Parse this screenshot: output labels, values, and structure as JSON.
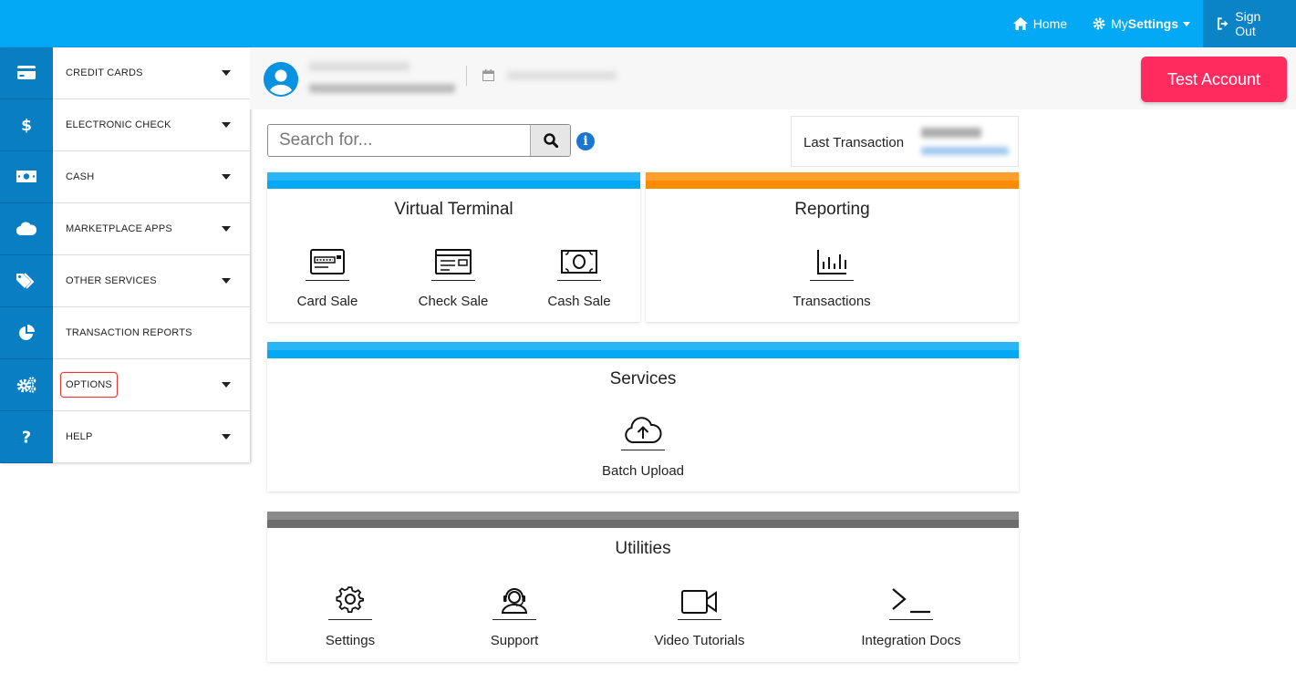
{
  "topnav": {
    "home": "Home",
    "my": "My ",
    "settings": "Settings",
    "signout": "Sign Out"
  },
  "sidebar": {
    "items": [
      {
        "label": "CREDIT CARDS",
        "icon": "credit-card-icon"
      },
      {
        "label": "ELECTRONIC CHECK",
        "icon": "dollar-icon"
      },
      {
        "label": "CASH",
        "icon": "cash-icon"
      },
      {
        "label": "MARKETPLACE APPS",
        "icon": "cloud-icon"
      },
      {
        "label": "OTHER SERVICES",
        "icon": "tags-icon"
      },
      {
        "label": "TRANSACTION REPORTS",
        "icon": "pie-chart-icon"
      },
      {
        "label": "OPTIONS",
        "icon": "cogs-icon"
      },
      {
        "label": "HELP",
        "icon": "question-icon"
      }
    ]
  },
  "header": {
    "test_account": "Test Account"
  },
  "search": {
    "placeholder": "Search for..."
  },
  "last_transaction": {
    "label": "Last Transaction"
  },
  "virtual_terminal": {
    "title": "Virtual Terminal",
    "tiles": [
      "Card Sale",
      "Check Sale",
      "Cash Sale"
    ]
  },
  "reporting": {
    "title": "Reporting",
    "tiles": [
      "Transactions"
    ]
  },
  "services": {
    "title": "Services",
    "tiles": [
      "Batch Upload"
    ]
  },
  "utilities": {
    "title": "Utilities",
    "tiles": [
      "Settings",
      "Support",
      "Video Tutorials",
      "Integration Docs"
    ]
  },
  "colors": {
    "topbar": "#03a9f4",
    "sidebar_icon_bg": "#0a7ec2",
    "test_button": "#ff2b5e",
    "reporting_bar": "#fb8c00",
    "utilities_bar": "#6d6d6d"
  }
}
